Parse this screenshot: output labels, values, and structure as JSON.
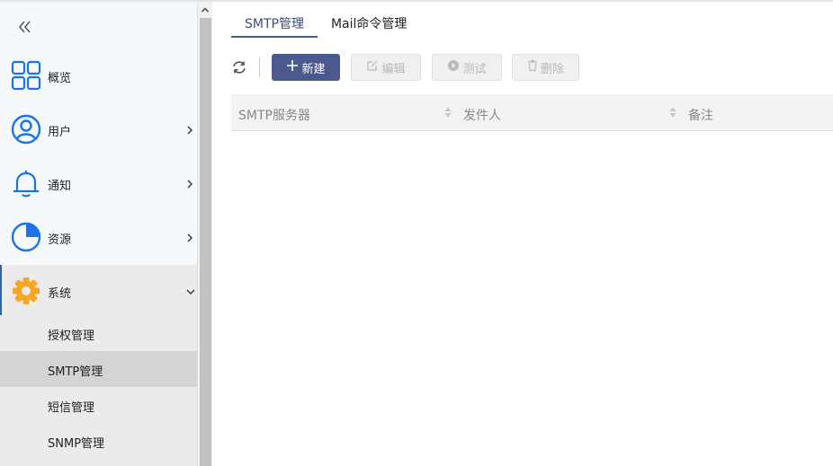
{
  "sidebar": {
    "collapse_icon": "double-chevron-left-icon",
    "items": [
      {
        "label": "概览",
        "icon": "grid-icon"
      },
      {
        "label": "用户",
        "icon": "user-icon"
      },
      {
        "label": "通知",
        "icon": "bell-icon"
      },
      {
        "label": "资源",
        "icon": "pie-icon"
      },
      {
        "label": "系统",
        "icon": "gear-icon"
      }
    ],
    "sub_items": [
      {
        "label": "授权管理"
      },
      {
        "label": "SMTP管理"
      },
      {
        "label": "短信管理"
      },
      {
        "label": "SNMP管理"
      }
    ]
  },
  "tabs": [
    {
      "label": "SMTP管理"
    },
    {
      "label": "Mail命令管理"
    }
  ],
  "toolbar": {
    "new_label": "新建",
    "edit_label": "编辑",
    "test_label": "测试",
    "delete_label": "删除"
  },
  "table": {
    "columns": [
      "SMTP服务器",
      "发件人",
      "备注"
    ]
  },
  "colors": {
    "primary": "#4a5a8e",
    "icon_blue": "#1a73e8",
    "gear_orange": "#f5a623"
  }
}
